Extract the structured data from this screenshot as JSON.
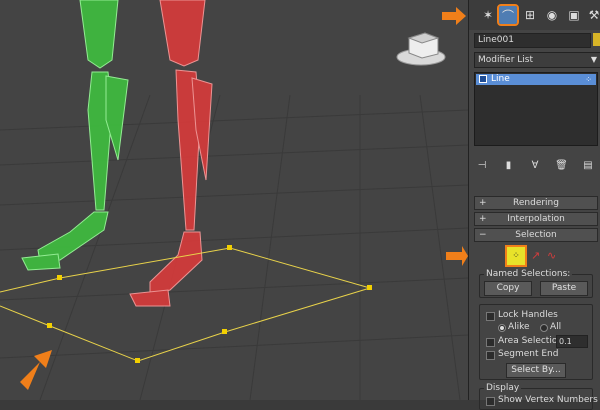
{
  "viewport": {
    "viewcube_label": "TOP"
  },
  "panel": {
    "object_name": "Line001",
    "colors": {
      "swatch": "#d7b427",
      "accent": "#f07f1a",
      "selection": "#5a8ed6"
    },
    "modifier_list_label": "Modifier List",
    "stack_items": [
      {
        "label": "Line"
      }
    ],
    "tabs": [
      {
        "name": "create-tab",
        "icon": "pointer-icon"
      },
      {
        "name": "modify-tab",
        "icon": "bend-icon"
      },
      {
        "name": "hierarchy-tab",
        "icon": "hierarchy-icon"
      },
      {
        "name": "motion-tab",
        "icon": "motion-icon"
      },
      {
        "name": "display-tab",
        "icon": "display-icon"
      },
      {
        "name": "utilities-tab",
        "icon": "hammer-icon"
      }
    ],
    "rollouts": {
      "rendering": "Rendering",
      "interpolation": "Interpolation",
      "selection": "Selection"
    },
    "named_selections": {
      "title": "Named Selections:",
      "copy": "Copy",
      "paste": "Paste"
    },
    "lock_handles": "Lock Handles",
    "alike": "Alike",
    "all": "All",
    "area_selection": "Area Selection:",
    "area_value": "0.1",
    "segment_end": "Segment End",
    "select_by": "Select By...",
    "display_title": "Display",
    "show_vertex_numbers": "Show Vertex Numbers"
  }
}
